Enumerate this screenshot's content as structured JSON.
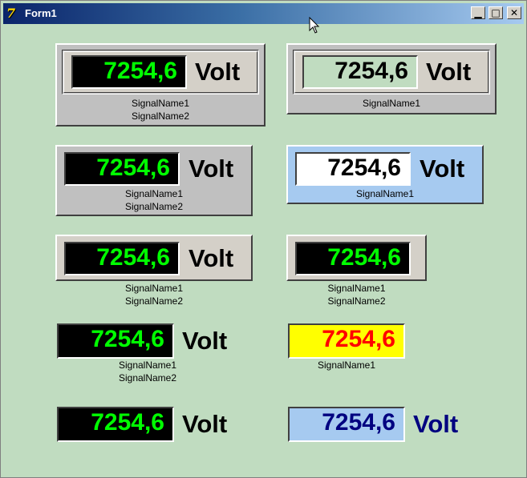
{
  "window": {
    "title": "Form1",
    "min_glyph": "▁",
    "max_glyph": "□",
    "close_glyph": "✕",
    "icon_glyph": "7"
  },
  "meter": {
    "value": "7254,6",
    "unit": "Volt",
    "signal1": "SignalName1",
    "signal2": "SignalName2"
  },
  "colors": {
    "background": "#c0dcc0",
    "digits_green": "#00ff00",
    "digits_red": "#ff0000",
    "digits_navy": "#000080",
    "panel_blue": "#a6caf0",
    "panel_yellow": "#ffff00"
  }
}
